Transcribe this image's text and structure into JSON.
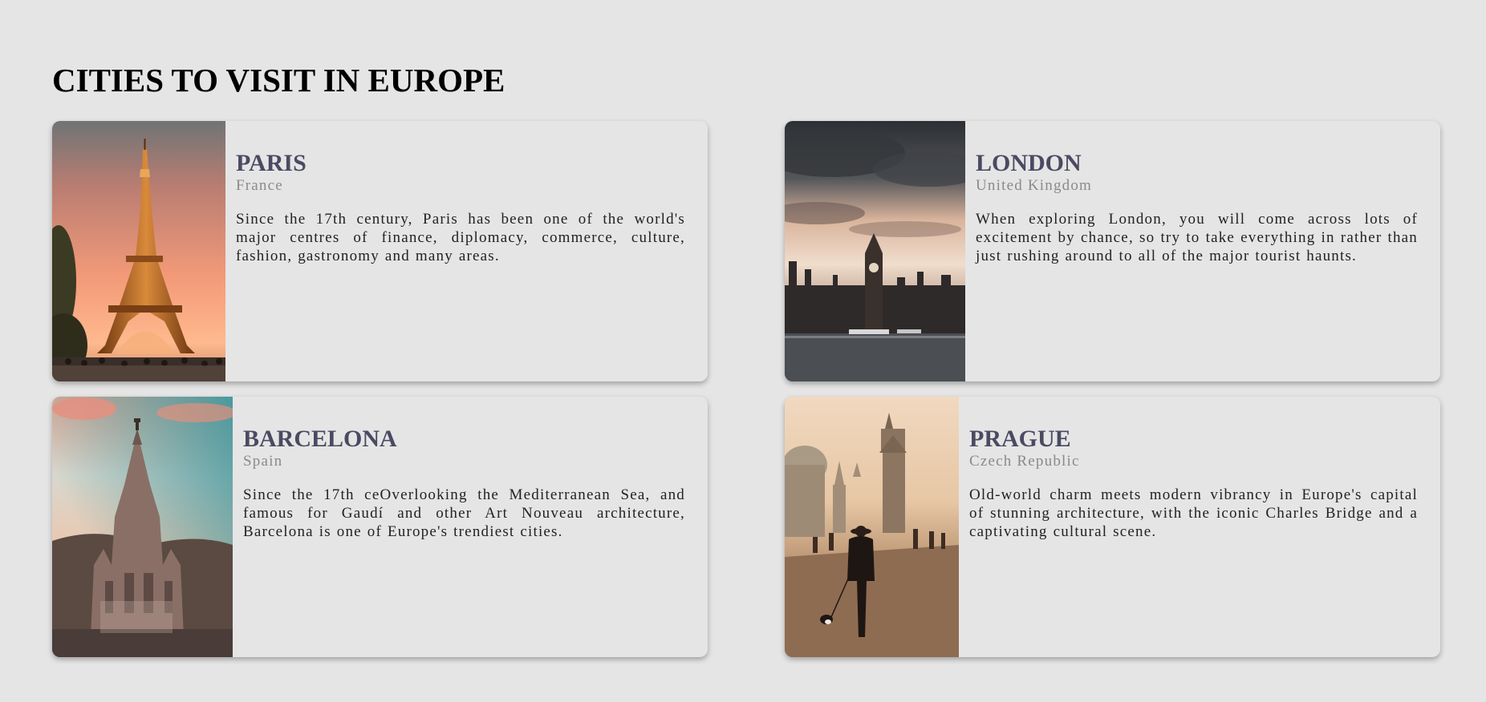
{
  "page": {
    "title": "CITIES TO VISIT IN EUROPE"
  },
  "cards": [
    {
      "city": "PARIS",
      "country": "France",
      "description": "Since the 17th century, Paris has been one of the world's major centres of finance, diplomacy, commerce, culture, fashion, gastronomy and many areas.",
      "image": "eiffel-tower-photo"
    },
    {
      "city": "LONDON",
      "country": "United Kingdom",
      "description": "When exploring London, you will come across lots of excitement by chance, so try to take everything in rather than just rushing around to all of the major tourist haunts.",
      "image": "big-ben-photo"
    },
    {
      "city": "BARCELONA",
      "country": "Spain",
      "description": "Since the 17th ceOverlooking the Mediterranean Sea, and famous for Gaudí and other Art Nouveau architecture, Barcelona is one of Europe's trendiest cities.",
      "image": "tibidabo-church-photo"
    },
    {
      "city": "PRAGUE",
      "country": "Czech Republic",
      "description": "Old-world charm meets modern vibrancy in Europe's capital of stunning architecture, with the iconic Charles Bridge and a captivating cultural scene.",
      "image": "charles-bridge-photo"
    }
  ],
  "colors": {
    "background": "#e5e5e5",
    "city_title": "#4a4a63",
    "country": "#8a8a8a",
    "body_text": "#222222"
  }
}
